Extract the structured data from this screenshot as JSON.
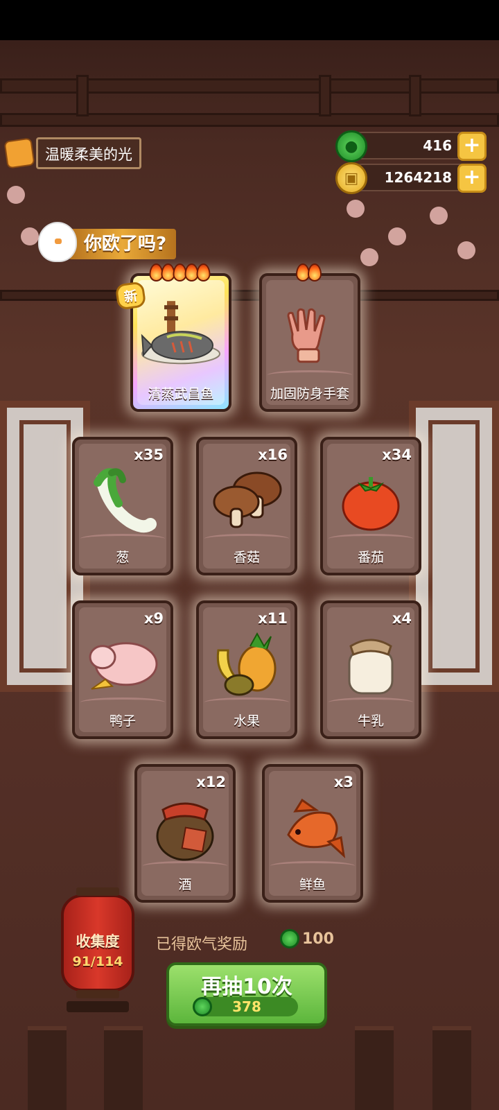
{
  "header": {
    "title": "温暖柔美的光",
    "banner": "你欧了吗?"
  },
  "currency": {
    "jade": "416",
    "coins": "1264218"
  },
  "special_cards": [
    {
      "name": "清蒸武昌鱼",
      "flames": 5,
      "is_new": true,
      "new_label": "新"
    },
    {
      "name": "加固防身手套",
      "flames": 2,
      "is_new": false
    }
  ],
  "cards": [
    {
      "name": "葱",
      "qty": "x35",
      "icon": "scallion-icon"
    },
    {
      "name": "香菇",
      "qty": "x16",
      "icon": "mushroom-icon"
    },
    {
      "name": "番茄",
      "qty": "x34",
      "icon": "tomato-icon"
    },
    {
      "name": "鸭子",
      "qty": "x9",
      "icon": "duck-icon"
    },
    {
      "name": "水果",
      "qty": "x11",
      "icon": "fruit-icon"
    },
    {
      "name": "牛乳",
      "qty": "x4",
      "icon": "milk-jar-icon"
    },
    {
      "name": "酒",
      "qty": "x12",
      "icon": "wine-jar-icon"
    },
    {
      "name": "鲜鱼",
      "qty": "x3",
      "icon": "fish-icon"
    }
  ],
  "collection": {
    "label": "收集度",
    "progress": "91/114"
  },
  "reward": {
    "label": "已得欧气奖励",
    "value": "100"
  },
  "draw_button": {
    "label": "再抽10次",
    "cost": "378"
  },
  "colors": {
    "background": "#553027",
    "card": "#76574e",
    "accent_green": "#5cb63c",
    "accent_gold": "#f5c542",
    "lantern_red": "#d9382a"
  }
}
